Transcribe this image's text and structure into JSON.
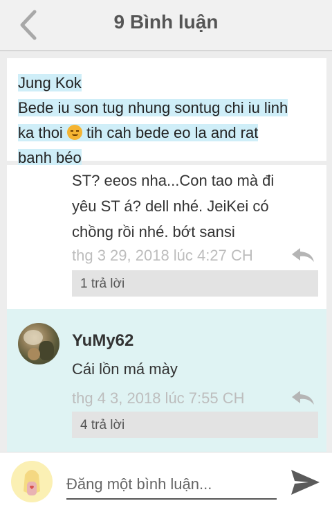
{
  "header": {
    "title": "9 Bình luận"
  },
  "quoted_comment": {
    "author": "Jung Kok",
    "line1": "Bede iu son tug nhung sontug chi iu linh",
    "line2_before": "ka thoi ",
    "line2_after": " tih cah bede eo la and rat",
    "line3": "banh béo",
    "emoji": "smirk-emoji"
  },
  "replies": [
    {
      "username": "",
      "text_lines": [
        "ST? eeos nha...Con tao mà đi",
        "yêu ST á? dell nhé. JeiKei có",
        "chồng rồi nhé. bớt sansi"
      ],
      "timestamp": "thg 3 29, 2018 lúc 4:27 CH",
      "reply_count": "1 trả lời"
    },
    {
      "username": "YuMy62",
      "text_lines": [
        "Cái lồn má mày"
      ],
      "timestamp": "thg 4 3, 2018 lúc 7:55 CH",
      "reply_count": "4 trả lời"
    }
  ],
  "composer": {
    "placeholder": "Đăng một bình luận..."
  },
  "icons": {
    "back": "chevron-left-icon",
    "reply": "reply-arrow-icon",
    "send": "send-icon"
  },
  "colors": {
    "highlight": "#cfeef8",
    "selected_reply_bg": "#dff3f3",
    "meta_text": "#bdbdbd"
  }
}
